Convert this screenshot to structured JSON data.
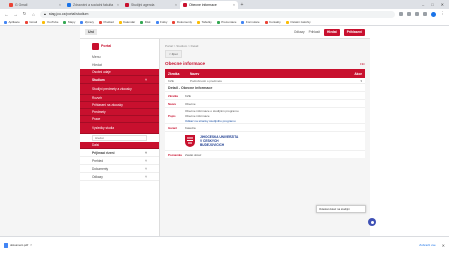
{
  "tabs": [
    {
      "label": "G Gmail",
      "color": "#ea4335",
      "active": false
    },
    {
      "label": "Zdravotni a socialni fakulta",
      "color": "#1a73e8",
      "active": false
    },
    {
      "label": "Studijni agenda",
      "color": "#c8102e",
      "active": false
    },
    {
      "label": "Obecne informace",
      "color": "#c8102e",
      "active": true
    }
  ],
  "address": {
    "url": "stag.jcu.cz/portal/studium"
  },
  "bookmarks": [
    "Aplikace",
    "Gmail",
    "YouTube",
    "Mapy",
    "Zpravy",
    "Preklad",
    "Kalendar",
    "Disk",
    "Fotky",
    "Dokumenty",
    "Tabulky",
    "Prezentace",
    "Formulare",
    "Kontakty",
    "Ostatni zalozky"
  ],
  "topnav": {
    "logo_label": "Uni",
    "links": [
      "Odkazy",
      "Prihlasit"
    ],
    "red_buttons": [
      "Hledat",
      "Prihlaseni"
    ]
  },
  "sidebar": {
    "brand": "Portal",
    "menu_label": "Menu",
    "search_label": "Hledat",
    "sections": [
      {
        "label": "Osobni udaje",
        "type": "red"
      },
      {
        "label": "Studium",
        "type": "red-section"
      },
      {
        "label": "Studijni predmety a zkousky",
        "type": "red-tall"
      },
      {
        "label": "Rozvrh",
        "type": "red"
      },
      {
        "label": "Prihlaseni na zkousky",
        "type": "red"
      },
      {
        "label": "Predmety",
        "type": "red"
      },
      {
        "label": "Prace",
        "type": "red"
      },
      {
        "label": "Vysledky studia",
        "type": "red-tall"
      }
    ],
    "search_placeholder": "Hledat",
    "after_search": {
      "label": "Dalsi",
      "type": "red"
    },
    "white_items": [
      {
        "label": "Prijimaci rizeni",
        "bold": true
      },
      {
        "label": "Prehled",
        "bold": false
      },
      {
        "label": "Dokumenty",
        "bold": false
      },
      {
        "label": "Odkazy",
        "bold": false
      }
    ]
  },
  "main": {
    "breadcrumb": "Portal > Studium > Detail",
    "back_label": "< Zpet",
    "title": "Obecne informace",
    "filter_label": "Filtr",
    "table_header": [
      "Zkratka",
      "Nazev",
      "Akce"
    ],
    "table_row": [
      "KZE",
      "Podrobnosti o predmetu",
      ""
    ],
    "detail_title": "Detail - Obecne informace",
    "details": [
      {
        "label": "Zkratka",
        "lines": [
          "KZE"
        ]
      },
      {
        "label": "Nazev",
        "lines": [
          "Obecne"
        ]
      },
      {
        "label": "Popis",
        "lines": [
          "Obecne informace o studijnim programu.",
          "Obecne informace",
          "Odkaz na stranky studijniho programu"
        ]
      },
      {
        "label": "Garant",
        "lines": [
          "Katedra"
        ]
      }
    ],
    "logo_lines": [
      "JIHOCESKA UNIVERZITA",
      "V CESKYCH",
      "BUDEJOVICICH"
    ],
    "footer_label": "Poznamka",
    "footer_value": "Zaslat dotaz"
  },
  "tooltip": "Odeslat dotaz na studijni",
  "downloads": {
    "file": "dokument.pdf",
    "show_all": "Zobrazit vse"
  }
}
